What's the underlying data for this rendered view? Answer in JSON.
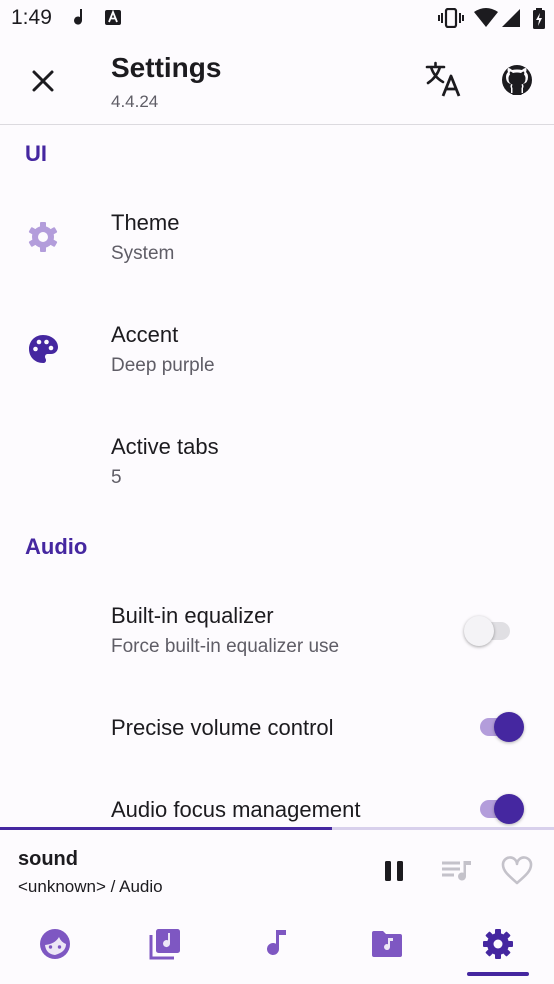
{
  "status_bar": {
    "time": "1:49"
  },
  "toolbar": {
    "title": "Settings",
    "version": "4.4.24"
  },
  "sections": {
    "ui": {
      "header": "UI",
      "items": [
        {
          "title": "Theme",
          "summary": "System"
        },
        {
          "title": "Accent",
          "summary": "Deep purple"
        },
        {
          "title": "Active tabs",
          "summary": "5"
        }
      ]
    },
    "audio": {
      "header": "Audio",
      "items": [
        {
          "title": "Built-in equalizer",
          "summary": "Force built-in equalizer use",
          "checked": false
        },
        {
          "title": "Precise volume control",
          "checked": true
        },
        {
          "title": "Audio focus management",
          "checked": true
        }
      ]
    }
  },
  "player": {
    "title": "sound",
    "subtitle": "<unknown> / Audio",
    "progress": 0.6,
    "state": "playing"
  },
  "bottom_nav": {
    "active_index": 4,
    "items": [
      "artists-icon",
      "albums-icon",
      "songs-icon",
      "folders-icon",
      "settings-icon"
    ]
  },
  "colors": {
    "accent": "#4527a0",
    "accent_light": "#b39ddb",
    "background": "#fdfbfe",
    "text": "#1c1b1f",
    "secondary_text": "#5f5d66"
  }
}
